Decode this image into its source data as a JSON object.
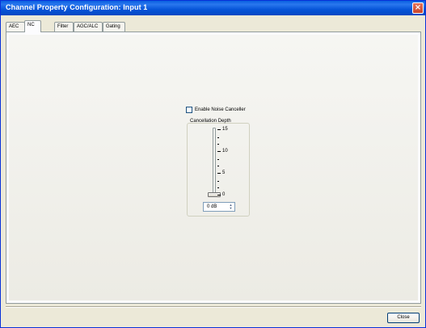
{
  "window": {
    "title": "Channel Property Configuration: Input 1",
    "close_glyph": "×"
  },
  "tabs": [
    {
      "label": "AEC",
      "active": false
    },
    {
      "label": "NC",
      "active": true
    },
    {
      "label": "Filter",
      "active": false
    },
    {
      "label": "AGC/ALC",
      "active": false
    },
    {
      "label": "Gating",
      "active": false
    }
  ],
  "nc": {
    "enable_label": "Enable Noise Canceller",
    "enabled": false,
    "depth_label": "Cancellation Depth",
    "ticks": [
      "15",
      "10",
      "5",
      "0"
    ],
    "value": "0 dB",
    "spin_up": "▲",
    "spin_down": "▼"
  },
  "footer": {
    "close_label": "Close"
  },
  "colors": {
    "titlebar": "#0a5fe0",
    "dialog_bg": "#ece9d8",
    "panel_bg": "#f6f6f3"
  },
  "icons": {
    "window_close": "close-icon",
    "spin_up": "spin-up-icon",
    "spin_down": "spin-down-icon"
  }
}
